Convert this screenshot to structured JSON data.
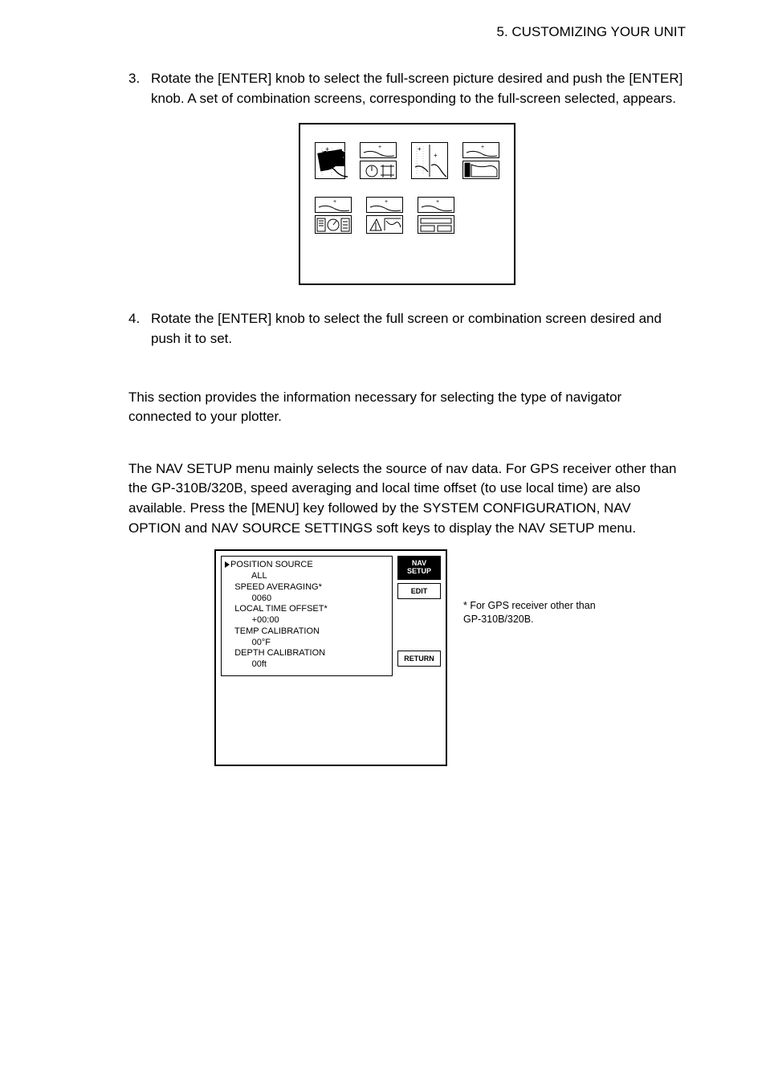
{
  "header": {
    "title": "5. CUSTOMIZING YOUR UNIT"
  },
  "steps": {
    "s3": {
      "num": "3.",
      "text": "Rotate the [ENTER] knob to select the full-screen picture desired and push the [ENTER] knob. A set of combination screens, corresponding to the full-screen selected, appears."
    },
    "s4": {
      "num": "4.",
      "text": "Rotate the [ENTER] knob to select the full screen or combination screen desired and push it to set."
    }
  },
  "paragraphs": {
    "p1": "This section provides the information necessary for selecting the type of navigator connected to your plotter.",
    "p2": "The NAV SETUP menu mainly selects the source of nav data. For GPS receiver other than the GP-310B/320B, speed averaging and local time offset (to use local time) are also available. Press the [MENU] key followed by the SYSTEM CONFIGURATION, NAV OPTION and NAV SOURCE SETTINGS soft keys to display the NAV SETUP menu."
  },
  "nav_setup": {
    "items": [
      {
        "label": "POSITION SOURCE",
        "value": "ALL",
        "selected": true
      },
      {
        "label": "SPEED AVERAGING*",
        "value": "0060"
      },
      {
        "label": "LOCAL TIME OFFSET*",
        "value": "+00:00"
      },
      {
        "label": "TEMP CALIBRATION",
        "value": "00°F"
      },
      {
        "label": "DEPTH CALIBRATION",
        "value": "00ft"
      }
    ],
    "buttons": {
      "title": "NAV\nSETUP",
      "edit": "EDIT",
      "ret": "RETURN"
    }
  },
  "footnote": "* For GPS receiver other than GP-310B/320B."
}
